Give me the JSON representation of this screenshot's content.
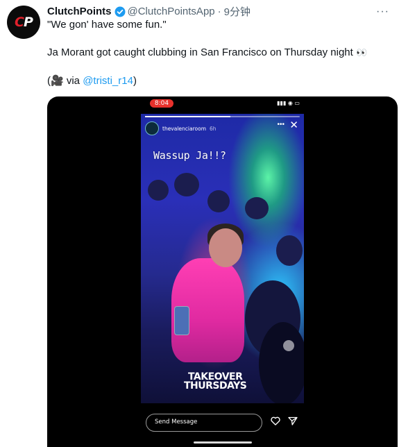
{
  "tweet": {
    "author_name": "ClutchPoints",
    "handle": "@ClutchPointsApp",
    "separator": "·",
    "time": "9分钟",
    "avatar_logo": "CP",
    "line1": "\"We gon' have some fun.\"",
    "line2": "Ja Morant got caught clubbing in San Francisco on Thursday night",
    "line2_emoji": "👀",
    "line3_prefix": "(🎥 via ",
    "line3_mention": "@tristi_r14",
    "line3_suffix": ")",
    "more_label": "···"
  },
  "video": {
    "phone_time": "8:04",
    "story_user": "thevalenciaroom",
    "story_age": "6h",
    "caption": "Wassup Ja!!?",
    "watermark_line1": "TAKEOVER",
    "watermark_line2": "THURSDAYS",
    "reply_placeholder": "Send Message"
  },
  "colors": {
    "accent": "#1d9bf0",
    "text": "#0f1419",
    "muted": "#536471",
    "logo_red": "#e0202b",
    "time_pill": "#e8312c"
  },
  "icons": [
    "verified-badge-icon",
    "more-icon",
    "heart-icon",
    "send-icon",
    "close-icon"
  ]
}
